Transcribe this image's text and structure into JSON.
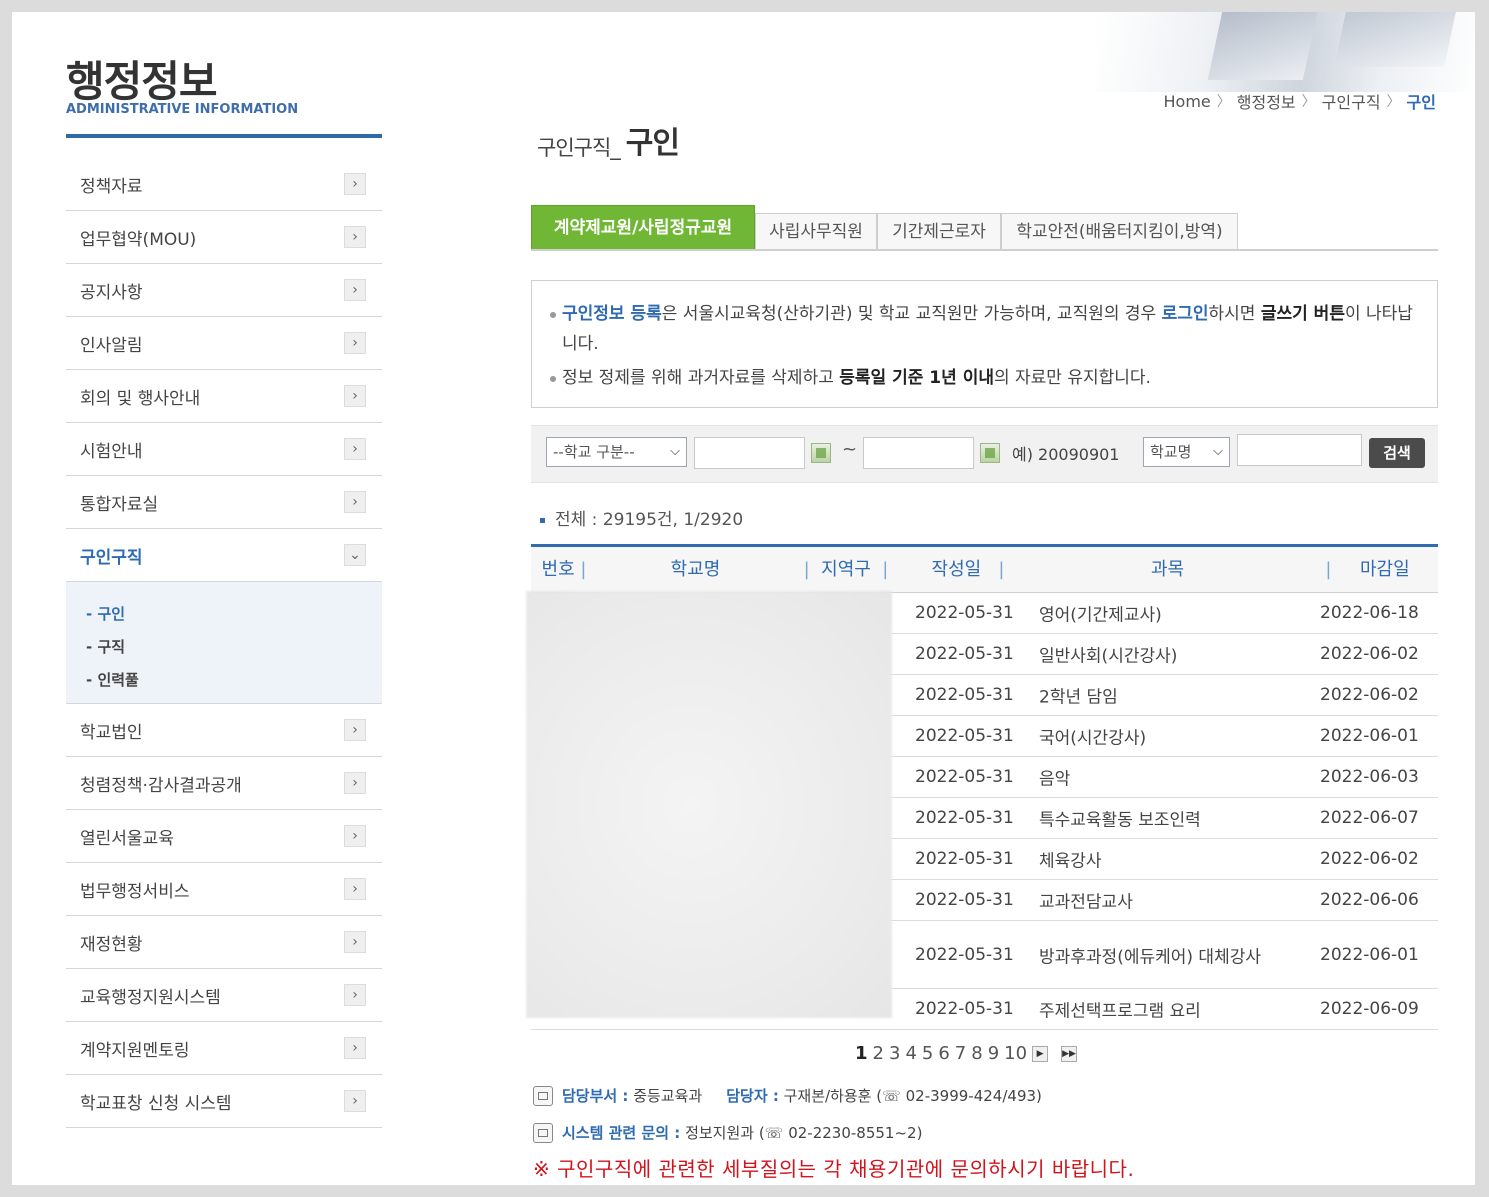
{
  "sidebar": {
    "title": "행정정보",
    "subtitle": "ADMINISTRATIVE INFORMATION",
    "items": [
      {
        "label": "정책자료"
      },
      {
        "label": "업무협약(MOU)"
      },
      {
        "label": "공지사항"
      },
      {
        "label": "인사알림"
      },
      {
        "label": "회의 및 행사안내"
      },
      {
        "label": "시험안내"
      },
      {
        "label": "통합자료실"
      },
      {
        "label": "구인구직"
      },
      {
        "label": "학교법인"
      },
      {
        "label": "청렴정책·감사결과공개"
      },
      {
        "label": "열린서울교육"
      },
      {
        "label": "법무행정서비스"
      },
      {
        "label": "재정현황"
      },
      {
        "label": "교육행정지원시스템"
      },
      {
        "label": "계약지원멘토링"
      },
      {
        "label": "학교표창 신청 시스템"
      }
    ],
    "subitems": [
      "- 구인",
      "- 구직",
      "- 인력풀"
    ]
  },
  "breadcrumb": {
    "home": "Home",
    "level1": "행정정보",
    "level2": "구인구직",
    "current": "구인"
  },
  "page": {
    "title_prefix": "구인구직_",
    "title": "구인"
  },
  "tabs": [
    "계약제교원/사립정규교원",
    "사립사무직원",
    "기간제근로자",
    "학교안전(배움터지킴이,방역)"
  ],
  "info": {
    "line1_a": "구인정보 등록",
    "line1_b": "은 서울시교육청(산하기관) 및 학교 교직원만 가능하며, 교직원의 경우 ",
    "line1_c": "로그인",
    "line1_d": "하시면 ",
    "line1_e": "글쓰기 버튼",
    "line1_f": "이 나타납니다.",
    "line2_a": "정보 정제를 위해 과거자료를 삭제하고 ",
    "line2_b": "등록일 기준 1년 이내",
    "line2_c": "의 자료만 유지합니다."
  },
  "search": {
    "school_type": "--학교 구분--",
    "tilde": "~",
    "example": "예) 20090901",
    "field": "학교명",
    "button": "검색"
  },
  "total": "전체 : 29195건, 1/2920",
  "table": {
    "headers": [
      "번호",
      "학교명",
      "지역구",
      "작성일",
      "과목",
      "마감일"
    ],
    "rows": [
      {
        "date": "2022-05-31",
        "subject": "영어(기간제교사)",
        "deadline": "2022-06-18"
      },
      {
        "date": "2022-05-31",
        "subject": "일반사회(시간강사)",
        "deadline": "2022-06-02"
      },
      {
        "date": "2022-05-31",
        "subject": "2학년 담임",
        "deadline": "2022-06-02"
      },
      {
        "date": "2022-05-31",
        "subject": "국어(시간강사)",
        "deadline": "2022-06-01"
      },
      {
        "date": "2022-05-31",
        "subject": "음악",
        "deadline": "2022-06-03"
      },
      {
        "date": "2022-05-31",
        "subject": "특수교육활동 보조인력",
        "deadline": "2022-06-07"
      },
      {
        "date": "2022-05-31",
        "subject": "체육강사",
        "deadline": "2022-06-02"
      },
      {
        "date": "2022-05-31",
        "subject": "교과전담교사",
        "deadline": "2022-06-06"
      },
      {
        "date": "2022-05-31",
        "subject": "방과후과정(에듀케어) 대체강사",
        "deadline": "2022-06-01"
      },
      {
        "date": "2022-05-31",
        "subject": "주제선택프로그램 요리",
        "deadline": "2022-06-09"
      }
    ]
  },
  "pagination": {
    "pages": [
      "1",
      "2",
      "3",
      "4",
      "5",
      "6",
      "7",
      "8",
      "9",
      "10"
    ],
    "next": "▶",
    "last": "▶▶"
  },
  "contact": {
    "dept_label": "담당부서 :",
    "dept": "중등교육과",
    "person_label": "담당자 :",
    "person": "구재본/하용훈 (☏ 02-3999-424/493)",
    "system_label": "시스템 관련 문의 :",
    "system": "정보지원과 (☏ 02-2230-8551~2)"
  },
  "notice": "※ 구인구직에 관련한 세부질의는 각 채용기관에 문의하시기 바랍니다.",
  "colors": {
    "accent": "#2f6bb0",
    "tab_active": "#6fb734",
    "notice": "#d0141b"
  }
}
